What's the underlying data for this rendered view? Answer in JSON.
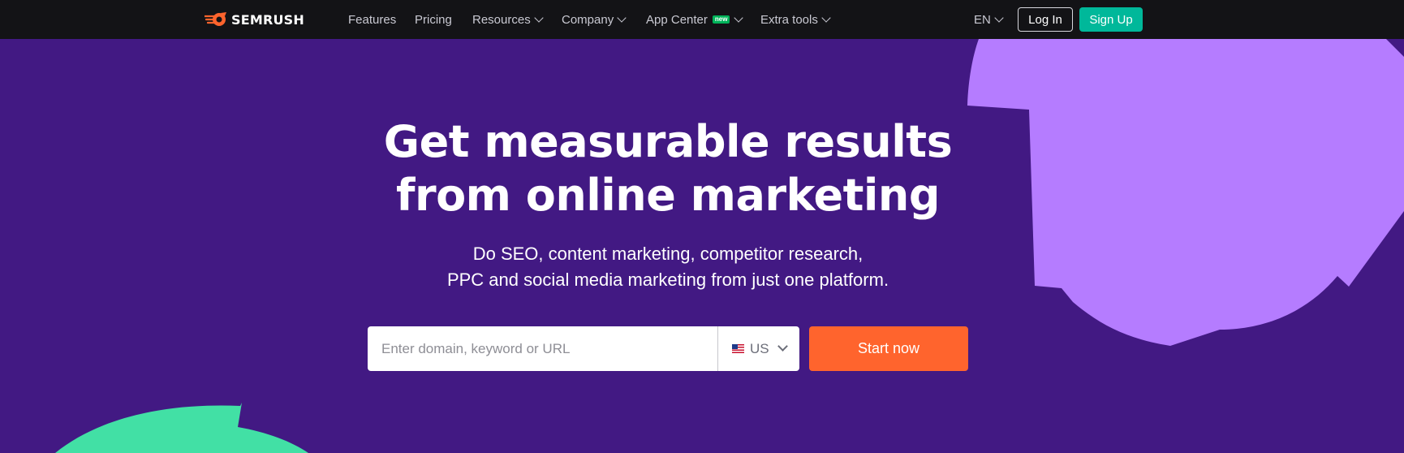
{
  "brand": {
    "name": "SEMRUSH",
    "logo_icon": "semrush-fire-icon",
    "accent": "#ff642d"
  },
  "nav": {
    "items": [
      {
        "label": "Features",
        "dropdown": false
      },
      {
        "label": "Pricing",
        "dropdown": false
      },
      {
        "label": "Resources",
        "dropdown": true
      },
      {
        "label": "Company",
        "dropdown": true
      },
      {
        "label": "App Center",
        "badge": "new",
        "dropdown": true
      },
      {
        "label": "Extra tools",
        "dropdown": true
      }
    ],
    "language": "EN",
    "login_label": "Log In",
    "signup_label": "Sign Up"
  },
  "hero": {
    "title_line1": "Get measurable results",
    "title_line2": "from online marketing",
    "subtitle_line1": "Do SEO, content marketing, competitor research,",
    "subtitle_line2": "PPC and social media marketing from just one platform."
  },
  "search": {
    "placeholder": "Enter domain, keyword or URL",
    "value": "",
    "database": "US",
    "database_icon": "us-flag-icon",
    "submit_label": "Start now"
  },
  "colors": {
    "background": "#421983",
    "nav_background": "#131316",
    "decor_purple": "#b57cff",
    "decor_green": "#42e0a5",
    "signup_button": "#00b89a",
    "start_button": "#ff642d"
  }
}
